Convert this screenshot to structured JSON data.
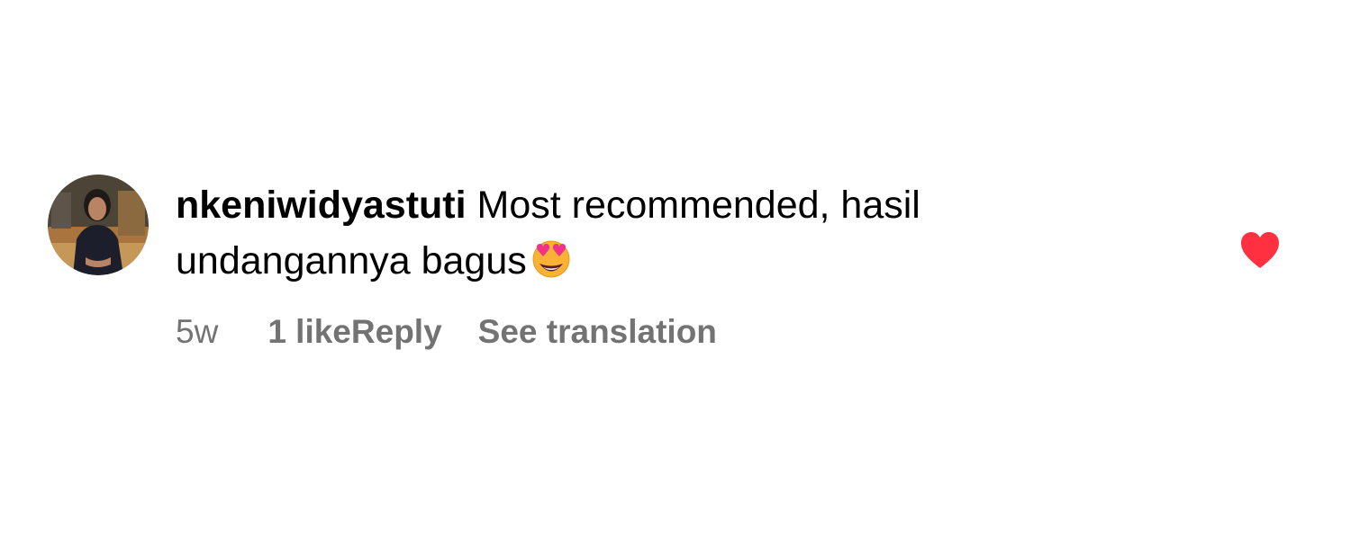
{
  "comment": {
    "username": "nkeniwidyastuti",
    "text": "Most recommended, hasil undangannya bagus",
    "emoji": "smiling-face-with-heart-eyes",
    "time": "5w",
    "likes": "1 like",
    "reply_label": "Reply",
    "translate_label": "See translation",
    "liked": true
  },
  "colors": {
    "text": "#000000",
    "meta": "#737373",
    "heart": "#ff3040"
  }
}
